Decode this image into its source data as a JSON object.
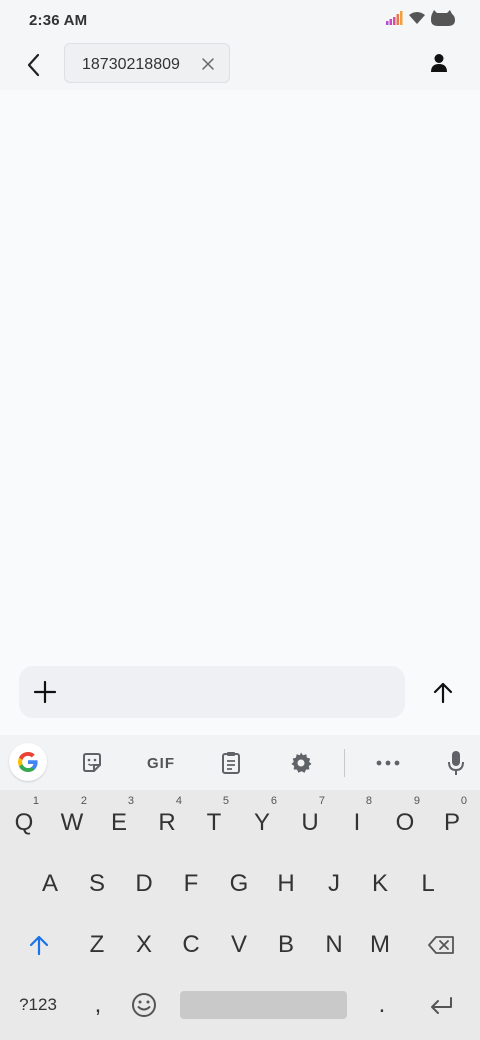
{
  "status_bar": {
    "time": "2:36 AM",
    "icons": [
      "signal-icon",
      "wifi-icon",
      "battery-icon"
    ]
  },
  "header": {
    "back_icon": "back-arrow-icon",
    "recipient": "18730218809",
    "recipient_remove_icon": "close-icon",
    "contact_icon": "person-icon"
  },
  "compose": {
    "attach_icon": "plus-icon",
    "send_icon": "send-arrow-up-icon",
    "text": ""
  },
  "keyboard": {
    "toolbar": [
      "google-icon",
      "sticker-icon",
      "GIF",
      "clipboard-icon",
      "gear-icon",
      "more-icon",
      "mic-icon"
    ],
    "row1": [
      {
        "label": "Q",
        "sup": "1"
      },
      {
        "label": "W",
        "sup": "2"
      },
      {
        "label": "E",
        "sup": "3"
      },
      {
        "label": "R",
        "sup": "4"
      },
      {
        "label": "T",
        "sup": "5"
      },
      {
        "label": "Y",
        "sup": "6"
      },
      {
        "label": "U",
        "sup": "7"
      },
      {
        "label": "I",
        "sup": "8"
      },
      {
        "label": "O",
        "sup": "9"
      },
      {
        "label": "P",
        "sup": "0"
      }
    ],
    "row2": [
      "A",
      "S",
      "D",
      "F",
      "G",
      "H",
      "J",
      "K",
      "L"
    ],
    "row3": [
      "Z",
      "X",
      "C",
      "V",
      "B",
      "N",
      "M"
    ],
    "row4": {
      "symbols": "?123",
      "comma": ",",
      "period": "."
    },
    "gif_label": "GIF"
  },
  "colors": {
    "accent_blue": "#1a73e8",
    "background": "#f9fafc",
    "keyboard_bg": "#e9e9e9"
  }
}
